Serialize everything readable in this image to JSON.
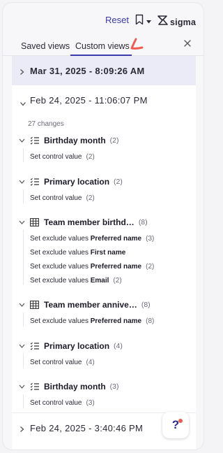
{
  "header": {
    "reset_label": "Reset",
    "logo_text": "sigma"
  },
  "tabs": [
    {
      "label": "Saved views",
      "active": false
    },
    {
      "label": "Custom views",
      "active": true
    }
  ],
  "versions": [
    {
      "label": "Mar 31, 2025 - 8:09:26 AM",
      "selected": true,
      "expanded": false
    },
    {
      "label": "Feb 24, 2025 - 11:06:07 PM",
      "selected": false,
      "expanded": true
    },
    {
      "label": "Feb 24, 2025 - 3:40:46 PM",
      "selected": false,
      "expanded": false
    }
  ],
  "expanded_version": {
    "changes_count": "27 changes",
    "groups": [
      {
        "icon": "list-filter-icon",
        "name": "Birthday month",
        "count": "(2)",
        "changes": [
          {
            "prefix": "Set control value",
            "bold": "",
            "count": "(2)"
          }
        ]
      },
      {
        "icon": "list-filter-icon",
        "name": "Primary location",
        "count": "(2)",
        "changes": [
          {
            "prefix": "Set control value",
            "bold": "",
            "count": "(2)"
          }
        ]
      },
      {
        "icon": "table-icon",
        "name": "Team member birthd…",
        "count": "(8)",
        "changes": [
          {
            "prefix": "Set exclude values",
            "bold": "Preferred name",
            "count": "(3)"
          },
          {
            "prefix": "Set exclude values",
            "bold": "First name",
            "count": ""
          },
          {
            "prefix": "Set exclude values",
            "bold": "Preferred name",
            "count": "(2)"
          },
          {
            "prefix": "Set exclude values",
            "bold": "Email",
            "count": "(2)"
          }
        ]
      },
      {
        "icon": "table-icon",
        "name": "Team member annive…",
        "count": "(8)",
        "changes": [
          {
            "prefix": "Set exclude values",
            "bold": "Preferred name",
            "count": "(8)"
          }
        ]
      },
      {
        "icon": "list-filter-icon",
        "name": "Primary location",
        "count": "(4)",
        "changes": [
          {
            "prefix": "Set control value",
            "bold": "",
            "count": "(4)"
          }
        ]
      },
      {
        "icon": "list-filter-icon",
        "name": "Birthday month",
        "count": "(3)",
        "changes": [
          {
            "prefix": "Set control value",
            "bold": "",
            "count": "(3)"
          }
        ]
      }
    ]
  },
  "help": {
    "label": "?"
  },
  "colors": {
    "accent": "#3a3aa8",
    "selected_bg": "#ebebf7",
    "annotation": "#ef5c4f"
  }
}
